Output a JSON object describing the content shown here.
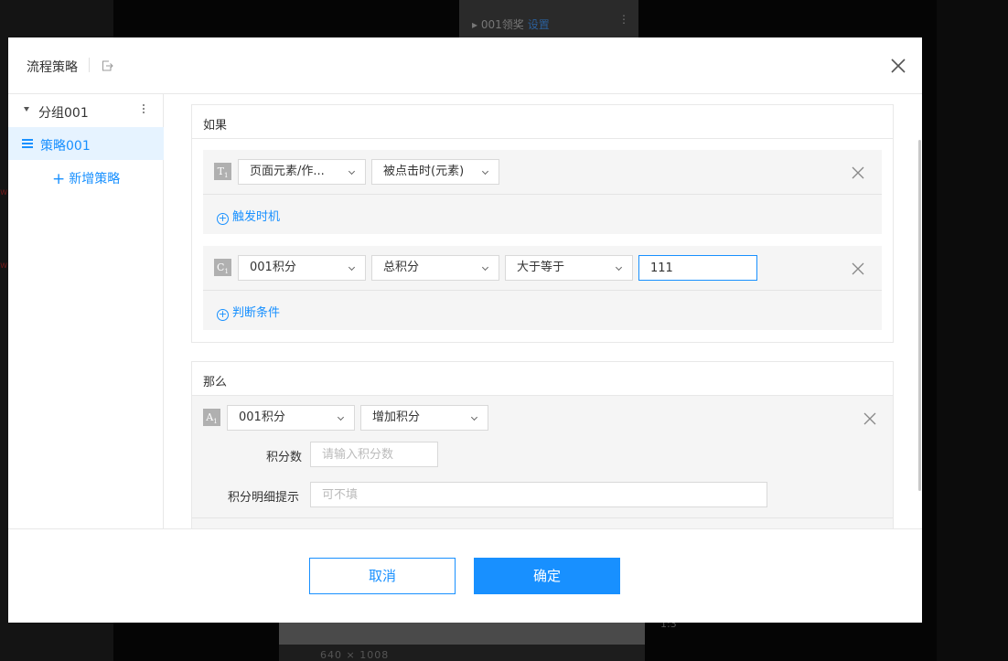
{
  "background": {
    "panel_item": "001领奖",
    "panel_link": "设置",
    "canvas_status": "640  ×  1008",
    "right_text": "1:3"
  },
  "modal": {
    "title": "流程策略",
    "sidebar": {
      "group_label": "分组001",
      "strategy_label": "策略001",
      "add_strategy_label": "新增策略"
    },
    "if_section": {
      "title": "如果",
      "trigger": {
        "badge": "T",
        "badge_sub": "1",
        "element_select": "页面元素/作...",
        "event_select": "被点击时(元素)",
        "add_label": "触发时机"
      },
      "condition": {
        "badge": "C",
        "badge_sub": "1",
        "source_select": "001积分",
        "field_select": "总积分",
        "operator_select": "大于等于",
        "value_input": "111",
        "add_label": "判断条件"
      }
    },
    "then_section": {
      "title": "那么",
      "action": {
        "badge": "A",
        "badge_sub": "1",
        "source_select": "001积分",
        "action_select": "增加积分",
        "points_label": "积分数",
        "points_placeholder": "请输入积分数",
        "detail_label": "积分明细提示",
        "detail_placeholder": "可不填"
      }
    },
    "footer": {
      "cancel_label": "取消",
      "ok_label": "确定"
    }
  },
  "colors": {
    "primary": "#1890ff",
    "selected_bg": "#e6f3ff",
    "block_bg": "#f5f5f5"
  }
}
